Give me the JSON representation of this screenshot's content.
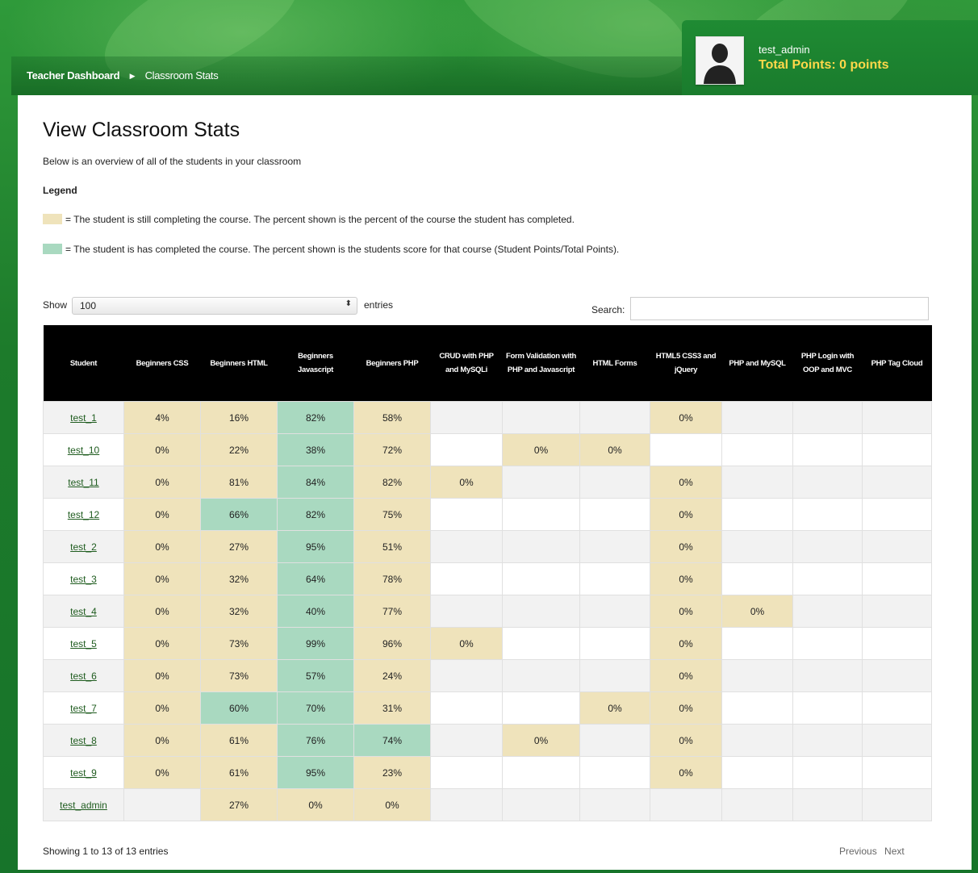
{
  "header": {
    "breadcrumb": {
      "home": "Teacher Dashboard",
      "current": "Classroom Stats"
    },
    "user": {
      "name": "test_admin",
      "points": "Total Points: 0 points"
    }
  },
  "page": {
    "title": "View Classroom Stats",
    "intro": "Below is an overview of all of the students in your classroom",
    "legend_title": "Legend",
    "legend": [
      {
        "color": "#efe3bb",
        "text": "= The student is still completing the course. The percent shown is the percent of the course the student has completed."
      },
      {
        "color": "#a9d9c0",
        "text": "= The student is has completed the course. The percent shown is the students score for that course (Student Points/Total Points)."
      }
    ]
  },
  "controls": {
    "show_label": "Show",
    "page_size": "100",
    "entries_label": "entries",
    "search_label": "Search:",
    "search_value": ""
  },
  "table": {
    "columns": [
      "Student",
      "Beginners CSS",
      "Beginners HTML",
      "Beginners Javascript",
      "Beginners PHP",
      "CRUD with PHP and MySQLi",
      "Form Validation with PHP and Javascript",
      "HTML Forms",
      "HTML5 CSS3 and jQuery",
      "PHP and MySQL",
      "PHP Login with OOP and MVC",
      "PHP Tag Cloud"
    ],
    "rows": [
      {
        "student": "test_1",
        "cells": [
          [
            "4%",
            "y"
          ],
          [
            "16%",
            "y"
          ],
          [
            "82%",
            "g"
          ],
          [
            "58%",
            "y"
          ],
          [
            "",
            ""
          ],
          [
            "",
            ""
          ],
          [
            "",
            ""
          ],
          [
            "0%",
            "y"
          ],
          [
            "",
            ""
          ],
          [
            "",
            ""
          ],
          [
            "",
            ""
          ]
        ]
      },
      {
        "student": "test_10",
        "cells": [
          [
            "0%",
            "y"
          ],
          [
            "22%",
            "y"
          ],
          [
            "38%",
            "g"
          ],
          [
            "72%",
            "y"
          ],
          [
            "",
            ""
          ],
          [
            "0%",
            "y"
          ],
          [
            "0%",
            "y"
          ],
          [
            "",
            ""
          ],
          [
            "",
            ""
          ],
          [
            "",
            ""
          ],
          [
            "",
            ""
          ]
        ]
      },
      {
        "student": "test_11",
        "cells": [
          [
            "0%",
            "y"
          ],
          [
            "81%",
            "y"
          ],
          [
            "84%",
            "g"
          ],
          [
            "82%",
            "y"
          ],
          [
            "0%",
            "y"
          ],
          [
            "",
            ""
          ],
          [
            "",
            ""
          ],
          [
            "0%",
            "y"
          ],
          [
            "",
            ""
          ],
          [
            "",
            ""
          ],
          [
            "",
            ""
          ]
        ]
      },
      {
        "student": "test_12",
        "cells": [
          [
            "0%",
            "y"
          ],
          [
            "66%",
            "g"
          ],
          [
            "82%",
            "g"
          ],
          [
            "75%",
            "y"
          ],
          [
            "",
            ""
          ],
          [
            "",
            ""
          ],
          [
            "",
            ""
          ],
          [
            "0%",
            "y"
          ],
          [
            "",
            ""
          ],
          [
            "",
            ""
          ],
          [
            "",
            ""
          ]
        ]
      },
      {
        "student": "test_2",
        "cells": [
          [
            "0%",
            "y"
          ],
          [
            "27%",
            "y"
          ],
          [
            "95%",
            "g"
          ],
          [
            "51%",
            "y"
          ],
          [
            "",
            ""
          ],
          [
            "",
            ""
          ],
          [
            "",
            ""
          ],
          [
            "0%",
            "y"
          ],
          [
            "",
            ""
          ],
          [
            "",
            ""
          ],
          [
            "",
            ""
          ]
        ]
      },
      {
        "student": "test_3",
        "cells": [
          [
            "0%",
            "y"
          ],
          [
            "32%",
            "y"
          ],
          [
            "64%",
            "g"
          ],
          [
            "78%",
            "y"
          ],
          [
            "",
            ""
          ],
          [
            "",
            ""
          ],
          [
            "",
            ""
          ],
          [
            "0%",
            "y"
          ],
          [
            "",
            ""
          ],
          [
            "",
            ""
          ],
          [
            "",
            ""
          ]
        ]
      },
      {
        "student": "test_4",
        "cells": [
          [
            "0%",
            "y"
          ],
          [
            "32%",
            "y"
          ],
          [
            "40%",
            "g"
          ],
          [
            "77%",
            "y"
          ],
          [
            "",
            ""
          ],
          [
            "",
            ""
          ],
          [
            "",
            ""
          ],
          [
            "0%",
            "y"
          ],
          [
            "0%",
            "y"
          ],
          [
            "",
            ""
          ],
          [
            "",
            ""
          ]
        ]
      },
      {
        "student": "test_5",
        "cells": [
          [
            "0%",
            "y"
          ],
          [
            "73%",
            "y"
          ],
          [
            "99%",
            "g"
          ],
          [
            "96%",
            "y"
          ],
          [
            "0%",
            "y"
          ],
          [
            "",
            ""
          ],
          [
            "",
            ""
          ],
          [
            "0%",
            "y"
          ],
          [
            "",
            ""
          ],
          [
            "",
            ""
          ],
          [
            "",
            ""
          ]
        ]
      },
      {
        "student": "test_6",
        "cells": [
          [
            "0%",
            "y"
          ],
          [
            "73%",
            "y"
          ],
          [
            "57%",
            "g"
          ],
          [
            "24%",
            "y"
          ],
          [
            "",
            ""
          ],
          [
            "",
            ""
          ],
          [
            "",
            ""
          ],
          [
            "0%",
            "y"
          ],
          [
            "",
            ""
          ],
          [
            "",
            ""
          ],
          [
            "",
            ""
          ]
        ]
      },
      {
        "student": "test_7",
        "cells": [
          [
            "0%",
            "y"
          ],
          [
            "60%",
            "g"
          ],
          [
            "70%",
            "g"
          ],
          [
            "31%",
            "y"
          ],
          [
            "",
            ""
          ],
          [
            "",
            ""
          ],
          [
            "0%",
            "y"
          ],
          [
            "0%",
            "y"
          ],
          [
            "",
            ""
          ],
          [
            "",
            ""
          ],
          [
            "",
            ""
          ]
        ]
      },
      {
        "student": "test_8",
        "cells": [
          [
            "0%",
            "y"
          ],
          [
            "61%",
            "y"
          ],
          [
            "76%",
            "g"
          ],
          [
            "74%",
            "g"
          ],
          [
            "",
            ""
          ],
          [
            "0%",
            "y"
          ],
          [
            "",
            ""
          ],
          [
            "0%",
            "y"
          ],
          [
            "",
            ""
          ],
          [
            "",
            ""
          ],
          [
            "",
            ""
          ]
        ]
      },
      {
        "student": "test_9",
        "cells": [
          [
            "0%",
            "y"
          ],
          [
            "61%",
            "y"
          ],
          [
            "95%",
            "g"
          ],
          [
            "23%",
            "y"
          ],
          [
            "",
            ""
          ],
          [
            "",
            ""
          ],
          [
            "",
            ""
          ],
          [
            "0%",
            "y"
          ],
          [
            "",
            ""
          ],
          [
            "",
            ""
          ],
          [
            "",
            ""
          ]
        ]
      },
      {
        "student": "test_admin",
        "cells": [
          [
            "",
            ""
          ],
          [
            "27%",
            "y"
          ],
          [
            "0%",
            "y"
          ],
          [
            "0%",
            "y"
          ],
          [
            "",
            ""
          ],
          [
            "",
            ""
          ],
          [
            "",
            ""
          ],
          [
            "",
            ""
          ],
          [
            "",
            ""
          ],
          [
            "",
            ""
          ],
          [
            "",
            ""
          ]
        ]
      }
    ]
  },
  "footer": {
    "info": "Showing 1 to 13 of 13 entries",
    "previous": "Previous",
    "next": "Next"
  }
}
